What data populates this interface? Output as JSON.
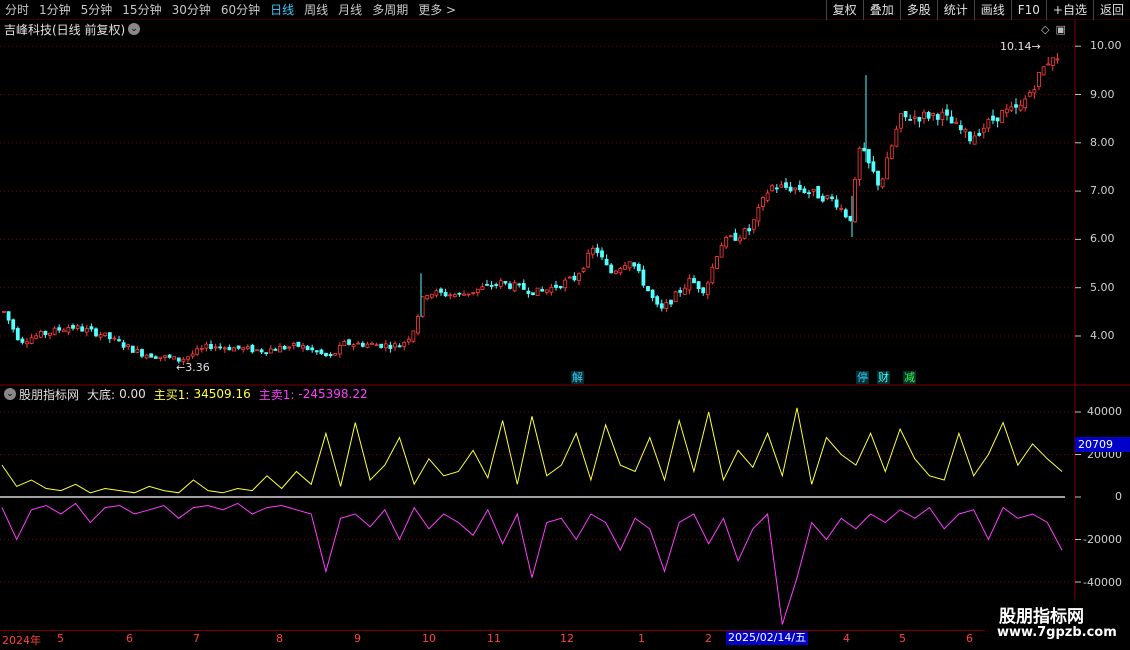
{
  "toolbar": {
    "periods": [
      "分时",
      "1分钟",
      "5分钟",
      "15分钟",
      "30分钟",
      "60分钟",
      "日线",
      "周线",
      "月线",
      "多周期",
      "更多 >"
    ],
    "active_period": "日线",
    "buttons": [
      "复权",
      "叠加",
      "多股",
      "统计",
      "画线",
      "F10",
      "+自选",
      "返回"
    ]
  },
  "main_chart": {
    "title": "吉峰科技(日线 前复权)",
    "high_label": "10.14",
    "low_label": "3.36",
    "y_ticks": [
      "10.00",
      "9.00",
      "8.00",
      "7.00",
      "6.00",
      "5.00",
      "4.00"
    ],
    "events": [
      {
        "label": "解",
        "color": "#3cc8ff"
      },
      {
        "label": "停",
        "color": "#3cc8ff"
      },
      {
        "label": "财",
        "color": "#3cffff"
      },
      {
        "label": "减",
        "color": "#3cff3c"
      }
    ]
  },
  "indicator": {
    "name": "股朋指标网",
    "dadi_label": "大底:",
    "dadi_value": "0.00",
    "buy_label": "主买1:",
    "buy_value": "34509.16",
    "sell_label": "主卖1:",
    "sell_value": "-245398.22",
    "y_ticks": [
      "40000",
      "20000",
      "0",
      "-20000",
      "-40000"
    ],
    "flag_value": "20709"
  },
  "date_axis": {
    "labels": [
      "2024年",
      "5",
      "6",
      "7",
      "8",
      "9",
      "10",
      "11",
      "12",
      "1",
      "2",
      "4",
      "5",
      "6"
    ],
    "cursor": "2025/02/14/五"
  },
  "watermark": {
    "title": "股朋指标网",
    "url": "www.7gpzb.com"
  },
  "colors": {
    "up": "#ff3c3c",
    "down": "#54ffff",
    "buy_line": "#ffff3c",
    "sell_line": "#ff3cff",
    "grid": "#800000",
    "active_tab": "#3cc8ff"
  },
  "chart_data": {
    "type": "line",
    "series": [
      {
        "name": "主买1",
        "values": [
          15000,
          5000,
          8000,
          4000,
          3000,
          6000,
          2000,
          4000,
          3000,
          2000,
          5000,
          3000,
          2000,
          8000,
          3000,
          2000,
          4000,
          3000,
          10000,
          4000,
          12000,
          6000,
          30000,
          5000,
          35000,
          8000,
          15000,
          28000,
          6000,
          18000,
          10000,
          12000,
          22000,
          9000,
          36000,
          6000,
          38000,
          10000,
          15000,
          30000,
          8000,
          34000,
          15000,
          12000,
          28000,
          8000,
          36000,
          12000,
          40000,
          8000,
          22000,
          14000,
          30000,
          10000,
          42000,
          6000,
          28000,
          20000,
          15000,
          30000,
          12000,
          32000,
          18000,
          10000,
          8000,
          30000,
          10000,
          20000,
          35000,
          15000,
          25000,
          18000,
          12000
        ]
      },
      {
        "name": "主卖1",
        "values": [
          -5000,
          -20000,
          -6000,
          -4000,
          -8000,
          -3000,
          -12000,
          -5000,
          -4000,
          -8000,
          -6000,
          -4000,
          -10000,
          -5000,
          -4000,
          -6000,
          -3000,
          -8000,
          -5000,
          -4000,
          -6000,
          -8000,
          -35000,
          -10000,
          -8000,
          -14000,
          -6000,
          -20000,
          -5000,
          -15000,
          -8000,
          -12000,
          -18000,
          -6000,
          -22000,
          -8000,
          -38000,
          -12000,
          -10000,
          -20000,
          -8000,
          -12000,
          -25000,
          -10000,
          -15000,
          -35000,
          -12000,
          -8000,
          -22000,
          -10000,
          -30000,
          -15000,
          -8000,
          -60000,
          -38000,
          -12000,
          -20000,
          -10000,
          -15000,
          -8000,
          -12000,
          -6000,
          -10000,
          -5000,
          -15000,
          -8000,
          -6000,
          -20000,
          -5000,
          -10000,
          -8000,
          -12000,
          -25000
        ]
      }
    ],
    "ylim": [
      -60000,
      45000
    ]
  }
}
